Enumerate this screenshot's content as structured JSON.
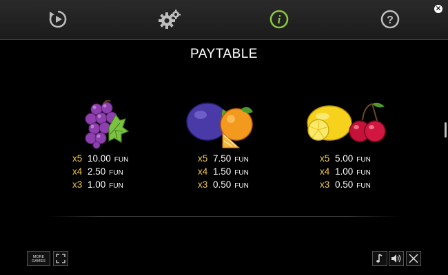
{
  "top_nav": {
    "icons": [
      "replay-icon",
      "settings-gear-icon",
      "info-icon",
      "help-icon"
    ],
    "active": "info-icon",
    "active_color": "#8dc63f"
  },
  "title": "PAYTABLE",
  "currency": "FUN",
  "symbols": [
    {
      "name": "grapes",
      "payouts": [
        {
          "mult": "x5",
          "value": "10.00"
        },
        {
          "mult": "x4",
          "value": "2.50"
        },
        {
          "mult": "x3",
          "value": "1.00"
        }
      ]
    },
    {
      "name": "plum-orange",
      "payouts": [
        {
          "mult": "x5",
          "value": "7.50"
        },
        {
          "mult": "x4",
          "value": "1.50"
        },
        {
          "mult": "x3",
          "value": "0.50"
        }
      ]
    },
    {
      "name": "lemon-cherries",
      "payouts": [
        {
          "mult": "x5",
          "value": "5.00"
        },
        {
          "mult": "x4",
          "value": "1.00"
        },
        {
          "mult": "x3",
          "value": "0.50"
        }
      ]
    }
  ],
  "bottom_bar": {
    "more_games_line1": "MORE",
    "more_games_line2": "GAMES"
  },
  "colors": {
    "multiplier": "#f2c94c",
    "background": "#000000"
  }
}
